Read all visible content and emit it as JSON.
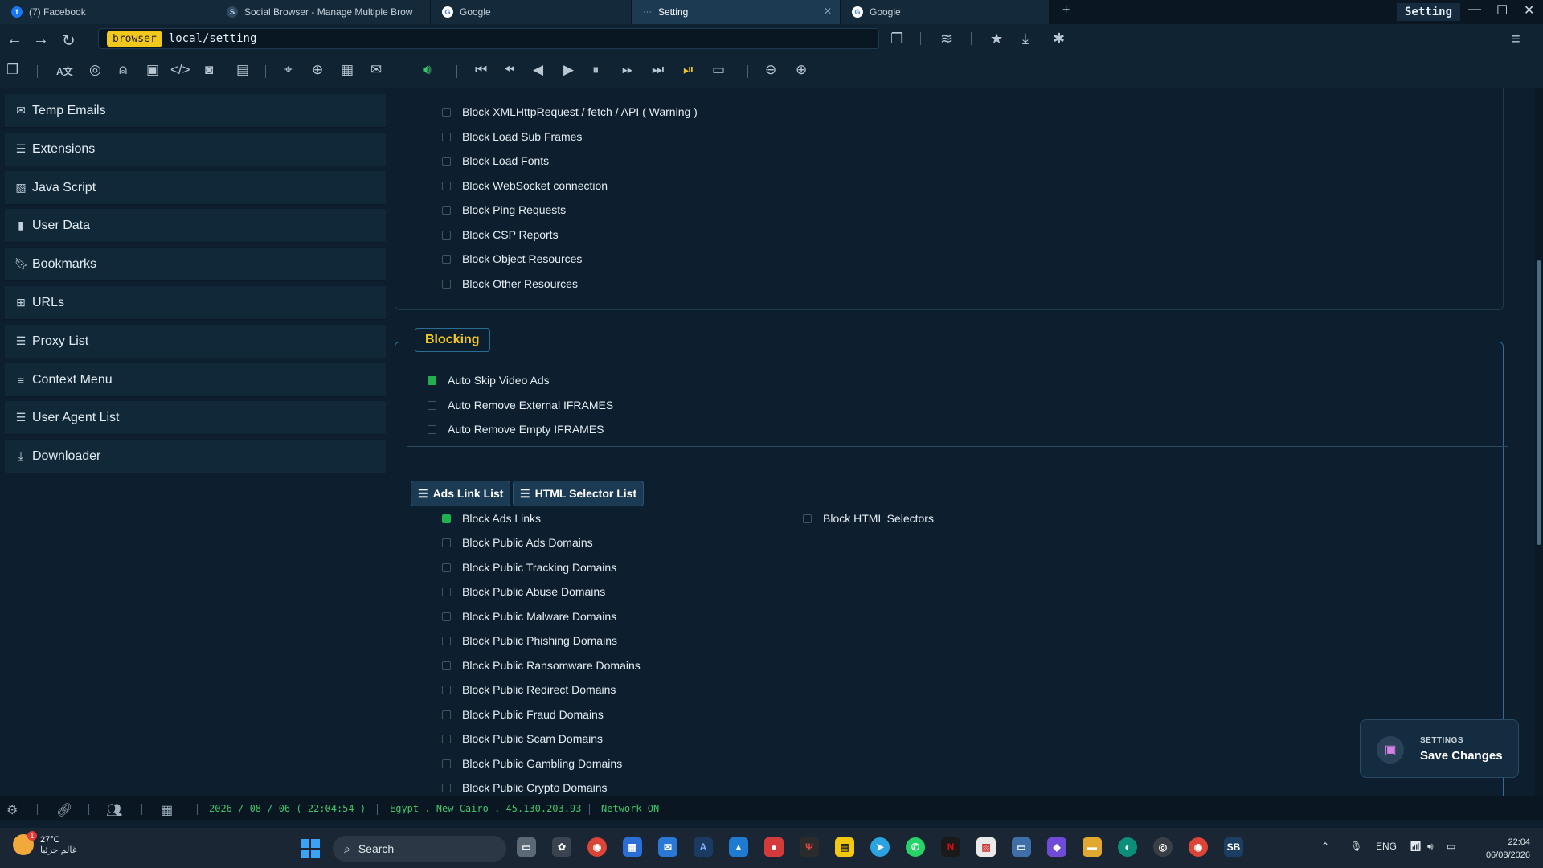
{
  "tabs": [
    {
      "label": "(7) Facebook"
    },
    {
      "label": "Social Browser - Manage Multiple Brow"
    },
    {
      "label": "Google"
    },
    {
      "label": "Setting"
    },
    {
      "label": "Google"
    }
  ],
  "window": {
    "title": "Setting"
  },
  "address": {
    "badge": "browser",
    "url": "local/setting"
  },
  "sidebar": {
    "items": [
      {
        "label": "Temp Emails",
        "icon": "envelope-icon"
      },
      {
        "label": "Extensions",
        "icon": "list-icon"
      },
      {
        "label": "Java Script",
        "icon": "script-icon"
      },
      {
        "label": "User Data",
        "icon": "file-icon"
      },
      {
        "label": "Bookmarks",
        "icon": "bookmark-icon"
      },
      {
        "label": "URLs",
        "icon": "sitemap-icon"
      },
      {
        "label": "Proxy List",
        "icon": "list-icon"
      },
      {
        "label": "Context Menu",
        "icon": "menu-icon"
      },
      {
        "label": "User Agent List",
        "icon": "list-icon"
      },
      {
        "label": "Downloader",
        "icon": "download-icon"
      }
    ]
  },
  "request_blocking": {
    "options": [
      {
        "label": "Block XMLHttpRequest / fetch / API ( Warning )",
        "checked": false
      },
      {
        "label": "Block Load Sub Frames",
        "checked": false
      },
      {
        "label": "Block Load Fonts",
        "checked": false
      },
      {
        "label": "Block WebSocket connection",
        "checked": false
      },
      {
        "label": "Block Ping Requests",
        "checked": false
      },
      {
        "label": "Block CSP Reports",
        "checked": false
      },
      {
        "label": "Block Object Resources",
        "checked": false
      },
      {
        "label": "Block Other Resources",
        "checked": false
      }
    ]
  },
  "blocking": {
    "title": "Blocking",
    "options": [
      {
        "label": "Auto Skip Video Ads",
        "checked": true
      },
      {
        "label": "Auto Remove External IFRAMES",
        "checked": false
      },
      {
        "label": "Auto Remove Empty IFRAMES",
        "checked": false
      }
    ],
    "tabs": [
      {
        "label": "Ads Link List"
      },
      {
        "label": "HTML Selector List"
      }
    ],
    "ads_options": [
      {
        "label": "Block Ads Links",
        "checked": true
      },
      {
        "label": "Block Public Ads Domains",
        "checked": false
      },
      {
        "label": "Block Public Tracking Domains",
        "checked": false
      },
      {
        "label": "Block Public Abuse Domains",
        "checked": false
      },
      {
        "label": "Block Public Malware Domains",
        "checked": false
      },
      {
        "label": "Block Public Phishing Domains",
        "checked": false
      },
      {
        "label": "Block Public Ransomware Domains",
        "checked": false
      },
      {
        "label": "Block Public Redirect Domains",
        "checked": false
      },
      {
        "label": "Block Public Fraud Domains",
        "checked": false
      },
      {
        "label": "Block Public Scam Domains",
        "checked": false
      },
      {
        "label": "Block Public Gambling Domains",
        "checked": false
      },
      {
        "label": "Block Public Crypto Domains",
        "checked": false
      }
    ],
    "selector_option": {
      "label": "Block HTML Selectors",
      "checked": false
    }
  },
  "toast": {
    "kicker": "SETTINGS",
    "action": "Save Changes"
  },
  "statusbar": {
    "datetime": "2026 / 08 / 06 ( 22:04:54 )",
    "location": "Egypt . New Cairo . 45.130.203.93",
    "network": "Network ON"
  },
  "taskbar": {
    "weather_temp": "27°C",
    "weather_text": "غالم جزئيا",
    "weather_badge": "1",
    "search_placeholder": "Search",
    "lang": "ENG",
    "time": "22:04",
    "date": "06/08/2026"
  },
  "colors": {
    "accent": "#f3c81d",
    "checked": "#22b04e",
    "background": "#0d1f2e"
  }
}
